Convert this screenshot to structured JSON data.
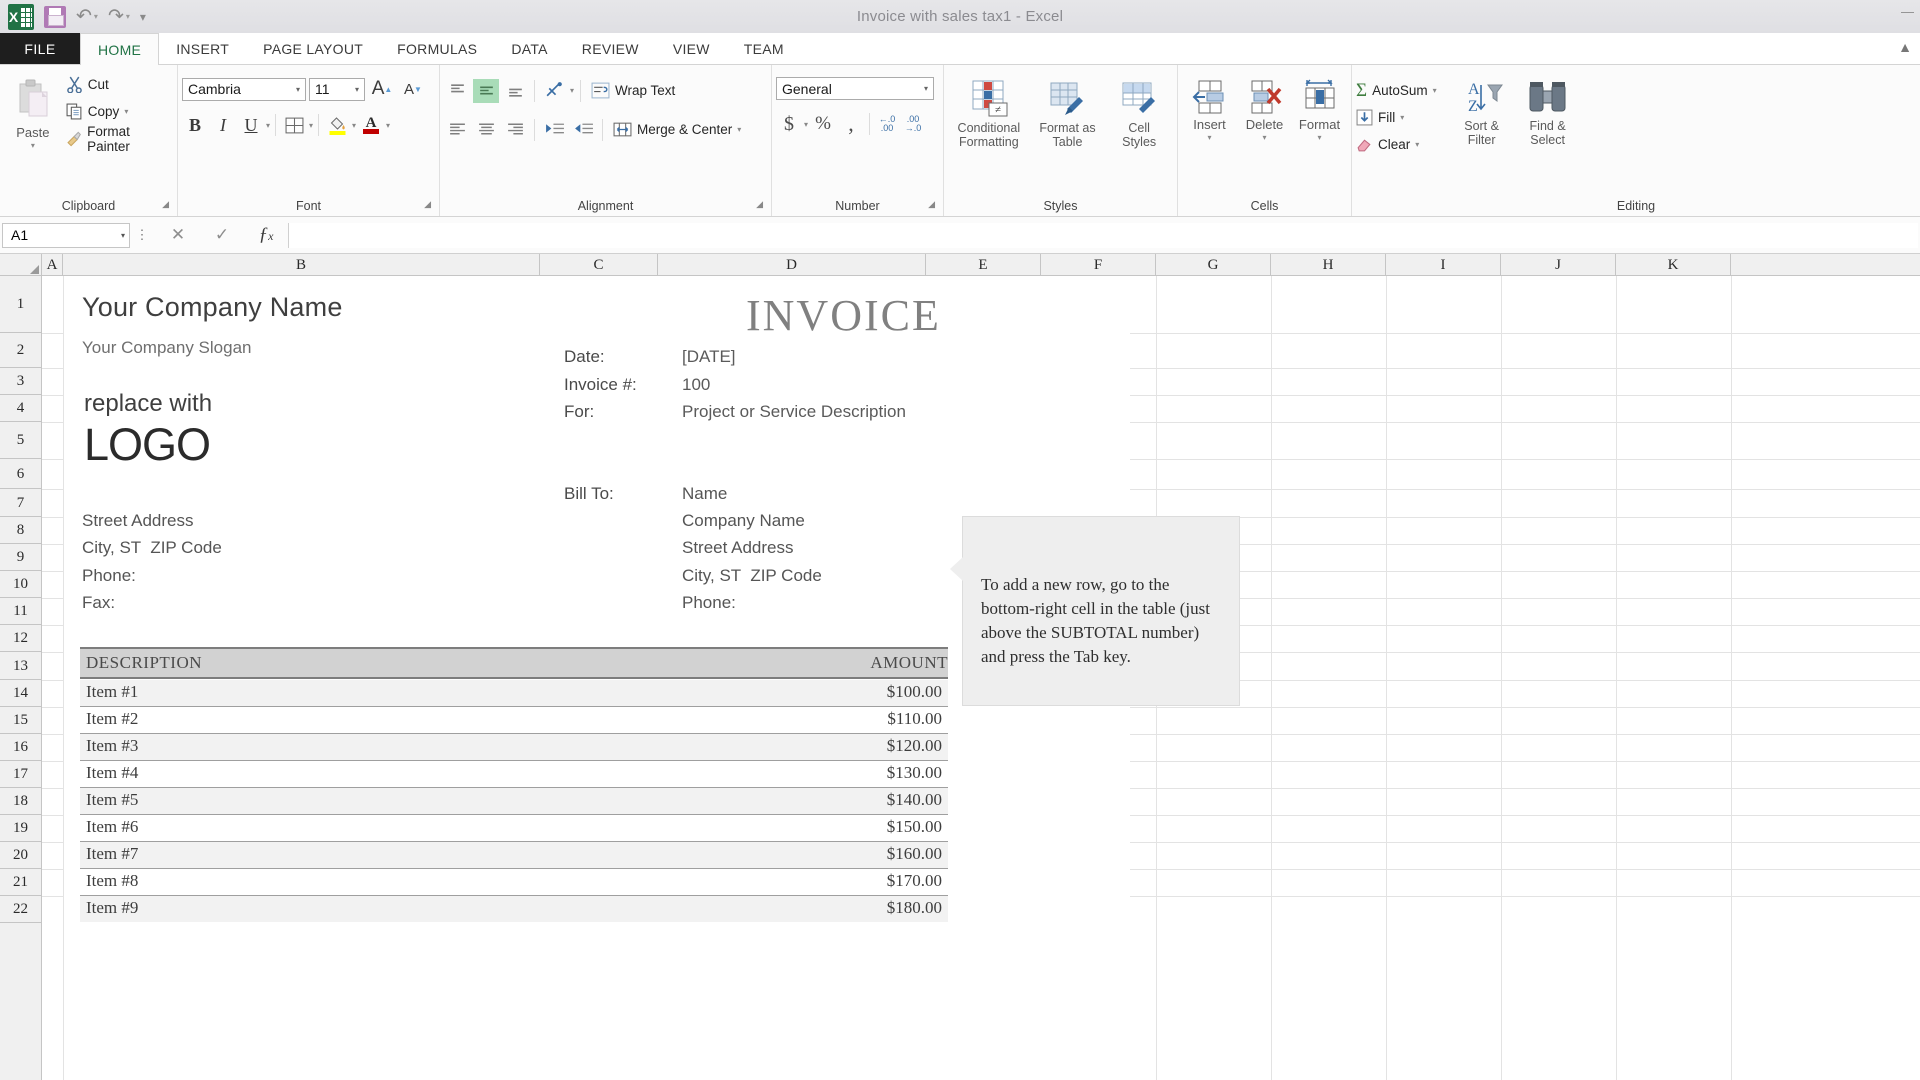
{
  "window": {
    "title": "Invoice with sales tax1 - Excel",
    "quick_access": [
      "save-icon",
      "undo-icon",
      "redo-icon",
      "customize-qat-icon"
    ],
    "app_icon": "excel-logo-icon",
    "window_controls": [
      "minimize-icon",
      "restore-icon",
      "close-icon"
    ]
  },
  "tabs": {
    "file_label": "FILE",
    "items": [
      {
        "label": "HOME",
        "active": true
      },
      {
        "label": "INSERT",
        "active": false
      },
      {
        "label": "PAGE LAYOUT",
        "active": false
      },
      {
        "label": "FORMULAS",
        "active": false
      },
      {
        "label": "DATA",
        "active": false
      },
      {
        "label": "REVIEW",
        "active": false
      },
      {
        "label": "VIEW",
        "active": false
      },
      {
        "label": "TEAM",
        "active": false
      }
    ]
  },
  "ribbon": {
    "clipboard": {
      "group_label": "Clipboard",
      "paste_label": "Paste",
      "cut_label": "Cut",
      "copy_label": "Copy",
      "format_painter_label": "Format Painter"
    },
    "font": {
      "group_label": "Font",
      "font_name": "Cambria",
      "font_size": "11",
      "bold_label": "B",
      "italic_label": "I",
      "underline_label": "U",
      "grow_font_label": "A",
      "shrink_font_label": "A",
      "fill_color": "#ffff00",
      "font_color": "#c00000"
    },
    "alignment": {
      "group_label": "Alignment",
      "wrap_text_label": "Wrap Text",
      "merge_center_label": "Merge & Center",
      "middle_align_active": true
    },
    "number": {
      "group_label": "Number",
      "format": "General",
      "currency_label": "$",
      "percent_label": "%",
      "comma_label": ",",
      "increase_decimal_label": ".00",
      "decrease_decimal_label": ".00"
    },
    "styles": {
      "group_label": "Styles",
      "conditional_formatting_label": "Conditional\nFormatting",
      "conditional_formatting_l1": "Conditional",
      "conditional_formatting_l2": "Formatting",
      "format_as_table_l1": "Format as",
      "format_as_table_l2": "Table",
      "cell_styles_l1": "Cell",
      "cell_styles_l2": "Styles"
    },
    "cells": {
      "group_label": "Cells",
      "insert_label": "Insert",
      "delete_label": "Delete",
      "format_label": "Format"
    },
    "editing": {
      "group_label": "Editing",
      "autosum_label": "AutoSum",
      "fill_label": "Fill",
      "clear_label": "Clear",
      "sort_filter_l1": "Sort &",
      "sort_filter_l2": "Filter",
      "find_select_l1": "Find &",
      "find_select_l2": "Select"
    }
  },
  "formula_bar": {
    "name_box": "A1",
    "formula": "",
    "cancel_icon": "cancel-icon",
    "enter_icon": "check-icon",
    "insert_function_icon": "fx-icon"
  },
  "grid": {
    "columns": [
      "A",
      "B",
      "C",
      "D",
      "E",
      "F",
      "G",
      "H",
      "I",
      "J",
      "K"
    ],
    "rows": [
      "1",
      "2",
      "3",
      "4",
      "5",
      "6",
      "7",
      "8",
      "9",
      "10",
      "11",
      "12",
      "13",
      "14",
      "15",
      "16",
      "17",
      "18",
      "19",
      "20",
      "21",
      "22"
    ],
    "active_cell": "A1"
  },
  "invoice": {
    "company_name": "Your Company Name",
    "company_slogan": "Your Company Slogan",
    "logo_line1": "replace with",
    "logo_line2": "LOGO",
    "title": "INVOICE",
    "fields": [
      {
        "label": "Date:",
        "value": "[DATE]"
      },
      {
        "label": "Invoice #:",
        "value": "100"
      },
      {
        "label": "For:",
        "value": "Project or Service Description"
      }
    ],
    "bill_to_label": "Bill To:",
    "bill_to": [
      "Name",
      "Company Name",
      "Street Address",
      "City, ST  ZIP Code",
      "Phone:"
    ],
    "sender_address": [
      "Street Address",
      "City, ST  ZIP Code",
      "Phone:",
      "Fax:"
    ],
    "table": {
      "headers": [
        "DESCRIPTION",
        "AMOUNT"
      ],
      "rows": [
        {
          "description": "Item #1",
          "amount": "$100.00"
        },
        {
          "description": "Item #2",
          "amount": "$110.00"
        },
        {
          "description": "Item #3",
          "amount": "$120.00"
        },
        {
          "description": "Item #4",
          "amount": "$130.00"
        },
        {
          "description": "Item #5",
          "amount": "$140.00"
        },
        {
          "description": "Item #6",
          "amount": "$150.00"
        },
        {
          "description": "Item #7",
          "amount": "$160.00"
        },
        {
          "description": "Item #8",
          "amount": "$170.00"
        },
        {
          "description": "Item #9",
          "amount": "$180.00"
        }
      ]
    }
  },
  "callout": {
    "text": "To add a new row, go to the bottom-right cell in the table (just above the SUBTOTAL number) and press the Tab key."
  }
}
